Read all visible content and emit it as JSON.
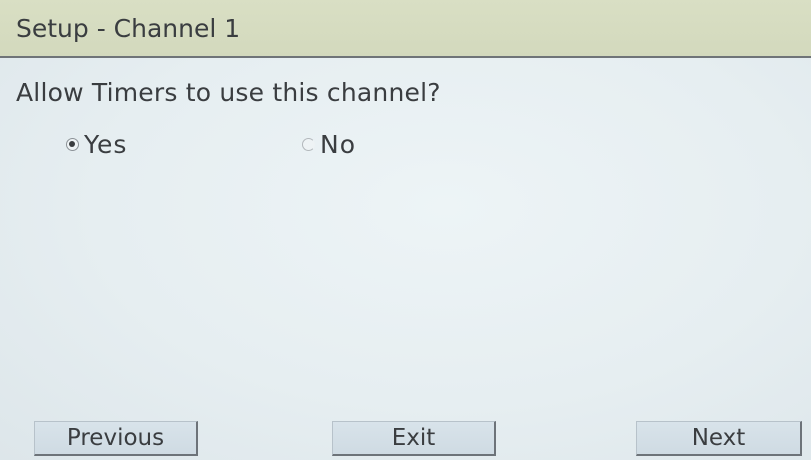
{
  "title_bar": {
    "title": "Setup - Channel 1"
  },
  "main": {
    "question": "Allow Timers to use this channel?",
    "options": [
      {
        "label": "Yes",
        "selected": true
      },
      {
        "label": "No",
        "selected": false
      }
    ]
  },
  "footer": {
    "previous_label": "Previous",
    "exit_label": "Exit",
    "next_label": "Next"
  },
  "colors": {
    "title_bar_bg": "#d6dcc0",
    "screen_bg": "#e8eff2",
    "button_bg": "#d4dfe7",
    "text": "#3a3d40"
  }
}
